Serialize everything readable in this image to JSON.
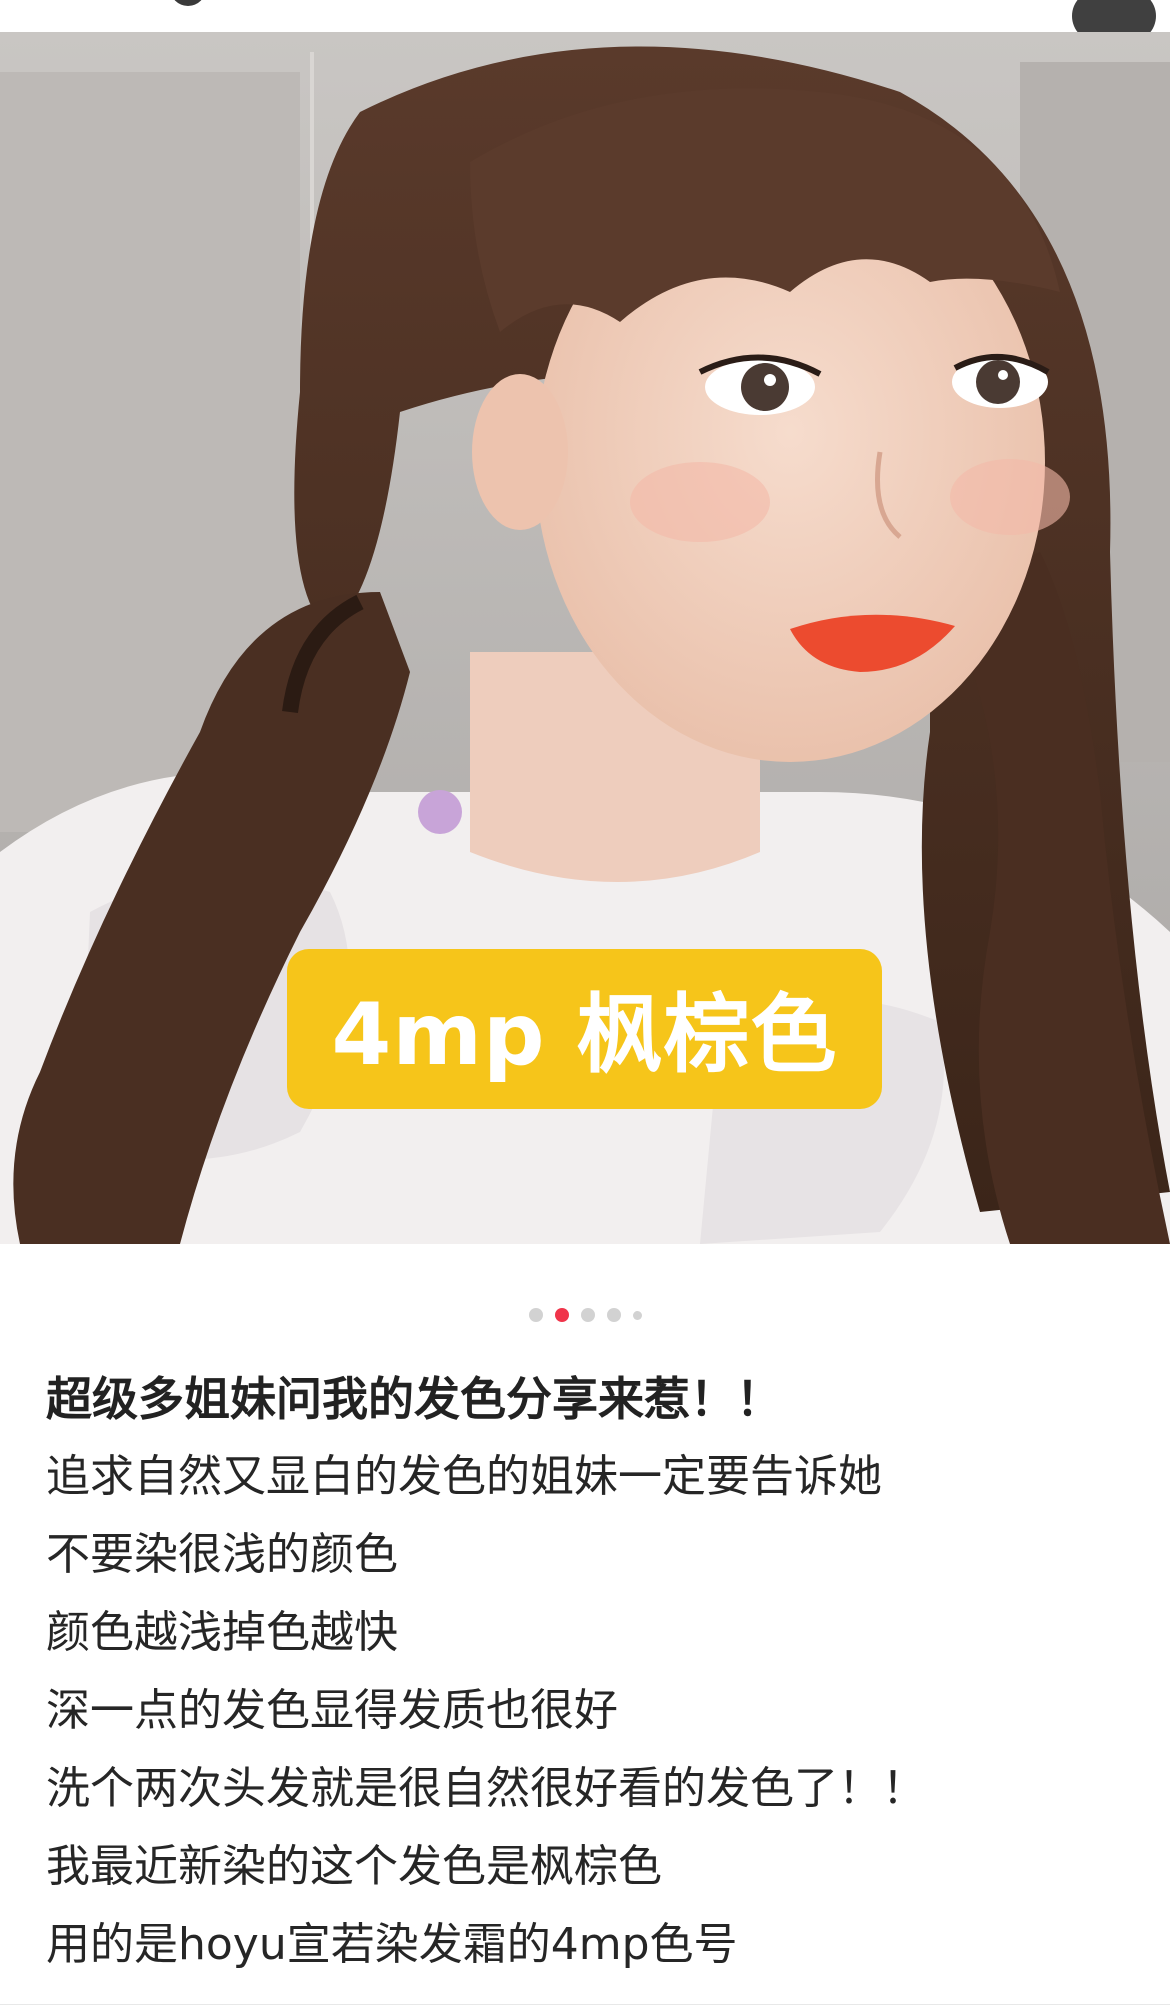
{
  "photo": {
    "overlay_label": "4mp 枫棕色"
  },
  "carousel": {
    "dot_count": 5,
    "active_index": 1
  },
  "post": {
    "title": "超级多姐妹问我的发色分享来惹！！",
    "lines": [
      "追求自然又显白的发色的姐妹一定要告诉她",
      "不要染很浅的颜色",
      "颜色越浅掉色越快",
      "深一点的发色显得发质也很好",
      "洗个两次头发就是很自然很好看的发色了！！",
      "我最近新染的这个发色是枫棕色",
      "用的是hoyu宣若染发霜的4mp色号"
    ]
  },
  "colors": {
    "tag_background": "#f6c51a",
    "active_dot": "#f0344a",
    "inactive_dot": "#d2d2d2"
  }
}
